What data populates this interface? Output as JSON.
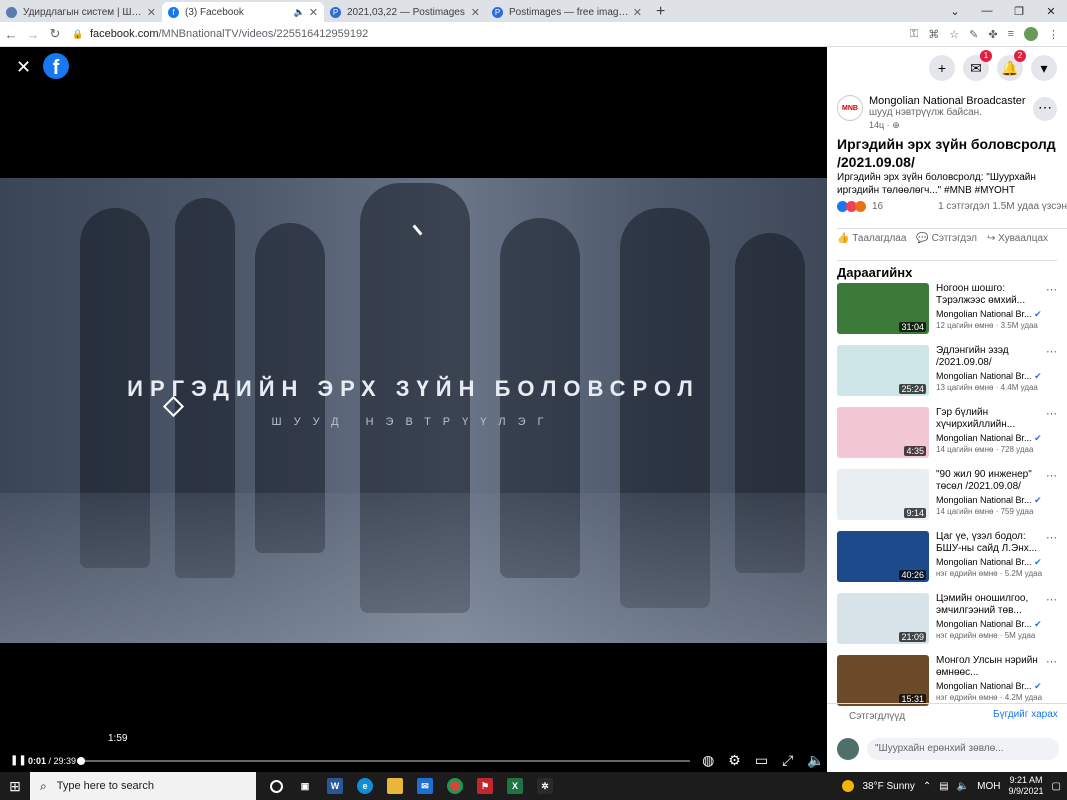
{
  "browser": {
    "tabs": [
      {
        "title": "Удирдлагын систем | Шуурхай",
        "fav_color": "#5a7bb0",
        "active": false
      },
      {
        "title": "(3) Facebook",
        "fav_color": "#1877f2",
        "active": true,
        "fav_glyph": "f"
      },
      {
        "title": "2021,03,22 — Postimages",
        "fav_color": "#2b6cd6",
        "active": false,
        "fav_glyph": "P"
      },
      {
        "title": "Postimages — free image hosting",
        "fav_color": "#2b6cd6",
        "active": false,
        "fav_glyph": "P"
      }
    ],
    "url_domain": "facebook.com",
    "url_path": "/MNBnationalTV/videos/225516412959192"
  },
  "video": {
    "title": "ИРГЭДИЙН ЭРХ ЗҮЙН БОЛОВСРОЛ",
    "subtitle": "ШУУД НЭВТРҮҮЛЭГ",
    "hover_time": "1:59",
    "current_time": "0:01",
    "duration": "/ 29:39",
    "progress": 0.002
  },
  "sidebar": {
    "page_name": "Mongolian National Broadcaster",
    "page_status": "шууд нэвтрүүлж байсан.",
    "post_time": "14ц ·",
    "logo_text": "MNB",
    "post_title": "Иргэдийн эрх зүйн боловсролд /2021.09.08/",
    "post_desc": "Иргэдийн эрх зүйн боловсролд: \"Шуурхайн иргэдийн төлөөлөгч...\" #MNB #МҮОНТ",
    "reaction_count": "16",
    "comments_views": "1 сэтгэгдэл  1.5M удаа үзсэн",
    "actions": {
      "like": "Таалагдлаа",
      "comment": "Сэтгэгдэл",
      "share": "Хуваалцах"
    },
    "next_heading": "Дараагийнх",
    "videos": [
      {
        "title": "Ногоон шошго: Тэрэлжээс өмхий...",
        "author": "Mongolian National Br...",
        "meta": "12 цагийн өмнө · 3.5M удаа",
        "duration": "31:04",
        "thumb": "#3c7a3a"
      },
      {
        "title": "Эдлэнгийн эзэд /2021.09.08/",
        "author": "Mongolian National Br...",
        "meta": "13 цагийн өмнө · 4.4M удаа",
        "duration": "25:24",
        "thumb": "#cfe6e8"
      },
      {
        "title": "Гэр бүлийн хүчирхийллийн...",
        "author": "Mongolian National Br...",
        "meta": "14 цагийн өмнө · 728 удаа",
        "duration": "4:35",
        "thumb": "#f3c7d4"
      },
      {
        "title": "\"90 жил 90 инженер\" төсөл /2021.09.08/",
        "author": "Mongolian National Br...",
        "meta": "14 цагийн өмнө · 759 удаа",
        "duration": "9:14",
        "thumb": "#e9eef2"
      },
      {
        "title": "Цаг үе, үзэл бодол: БШУ-ны сайд Л.Энх...",
        "author": "Mongolian National Br...",
        "meta": "нэг өдрийн өмнө · 5.2M удаа",
        "duration": "40:26",
        "thumb": "#1d4a8a"
      },
      {
        "title": "Цэмийн оношилгоо, эмчилгээний төв...",
        "author": "Mongolian National Br...",
        "meta": "нэг өдрийн өмнө · 5M удаа",
        "duration": "21:09",
        "thumb": "#d8e4ea"
      },
      {
        "title": "Монгол Улсын нэрийн өмнөөс...",
        "author": "Mongolian National Br...",
        "meta": "нэг өдрийн өмнө · 4.2M удаа",
        "duration": "15:31",
        "thumb": "#6b4a2a"
      }
    ],
    "comments_label": "Сэтгэгдлүүд",
    "see_all": "Бүгдийг харах",
    "comment_placeholder": "\"Шуурхайн ерөнхий зөвлө..."
  },
  "taskbar": {
    "search_placeholder": "Type here to search",
    "weather": "38°F  Sunny",
    "lang": "МОН",
    "time": "9:21 AM",
    "date": "9/9/2021"
  },
  "badges": {
    "messenger": "1",
    "notifications": "2"
  }
}
